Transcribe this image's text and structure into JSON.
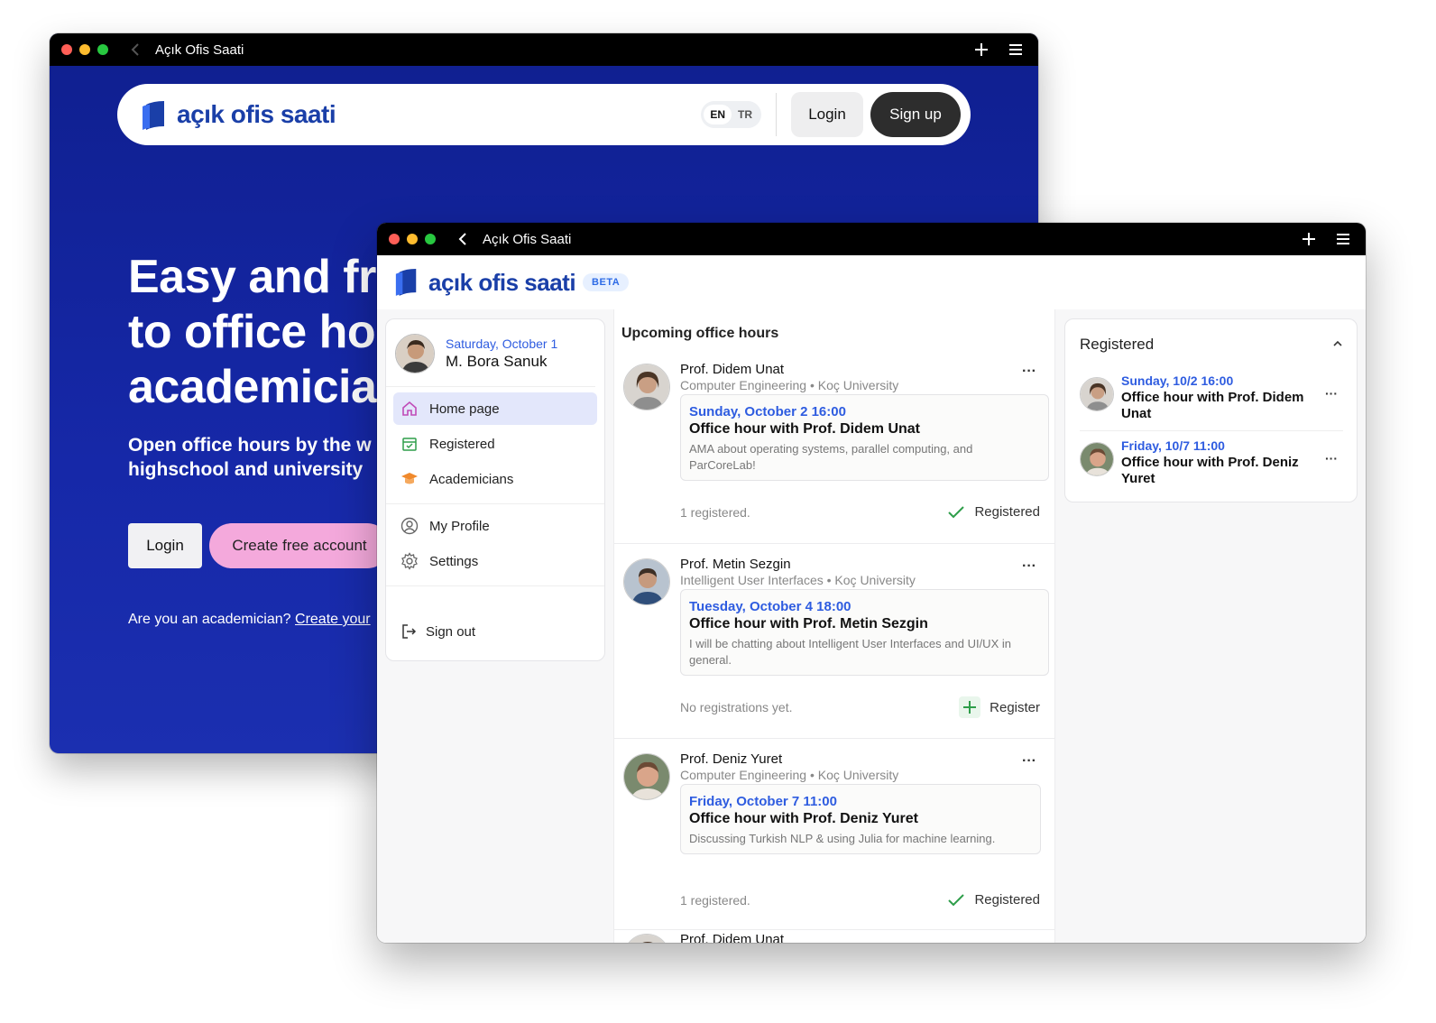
{
  "back_window": {
    "title": "Açık Ofis Saati",
    "logo_text": "açık ofis saati",
    "lang": [
      "EN",
      "TR"
    ],
    "login": "Login",
    "signup": "Sign up",
    "hero_title": "Easy and fr\nto office ho\nacademicia",
    "hero_sub": "Open office hours by the w\nhighschool and university",
    "hero_login": "Login",
    "hero_create": "Create free account",
    "hero_acad_prefix": "Are you an academician?",
    "hero_acad_link": "Create your"
  },
  "front_window": {
    "title": "Açık Ofis Saati",
    "logo_text": "açık ofis saati",
    "beta": "BETA",
    "user": {
      "date": "Saturday, October 1",
      "name": "M. Bora Sanuk"
    },
    "nav": {
      "home": "Home page",
      "registered": "Registered",
      "academicians": "Academicians",
      "profile": "My Profile",
      "settings": "Settings",
      "signout": "Sign out"
    },
    "feed": {
      "title": "Upcoming office hours",
      "cards": [
        {
          "prof": "Prof. Didem Unat",
          "dept": "Computer Engineering • Koç University",
          "when": "Sunday, October 2 16:00",
          "what": "Office hour with Prof. Didem Unat",
          "desc": "AMA about operating systems, parallel computing, and ParCoreLab!",
          "status": "1 registered.",
          "action": "Registered"
        },
        {
          "prof": "Prof. Metin Sezgin",
          "dept": "Intelligent User Interfaces • Koç University",
          "when": "Tuesday, October 4 18:00",
          "what": "Office hour with Prof. Metin Sezgin",
          "desc": "I will be chatting about Intelligent User Interfaces and UI/UX in general.",
          "status": "No registrations yet.",
          "action": "Register"
        },
        {
          "prof": "Prof. Deniz Yuret",
          "dept": "Computer Engineering • Koç University",
          "when": "Friday, October 7 11:00",
          "what": "Office hour with Prof. Deniz Yuret",
          "desc": "Discussing Turkish NLP & using Julia for machine learning.",
          "status": "1 registered.",
          "action": "Registered"
        },
        {
          "prof": "Prof. Didem Unat"
        }
      ]
    },
    "registered_panel": {
      "title": "Registered",
      "items": [
        {
          "when": "Sunday, 10/2 16:00",
          "what": "Office hour with Prof. Didem Unat"
        },
        {
          "when": "Friday, 10/7 11:00",
          "what": "Office hour with Prof. Deniz Yuret"
        }
      ]
    }
  },
  "colors": {
    "brand_blue": "#1a3fa8",
    "link_blue": "#2e5ce0",
    "hero_bg": "#1628a8",
    "create_pink": "#f4a9dc",
    "success_green": "#2e9e4a"
  },
  "icons": [
    "logo-mark-icon",
    "back-chevron-icon",
    "plus-icon",
    "menu-icon",
    "home-icon",
    "calendar-check-icon",
    "graduation-cap-icon",
    "user-circle-icon",
    "gear-icon",
    "sign-out-icon",
    "more-icon",
    "check-icon",
    "chevron-up-icon"
  ]
}
